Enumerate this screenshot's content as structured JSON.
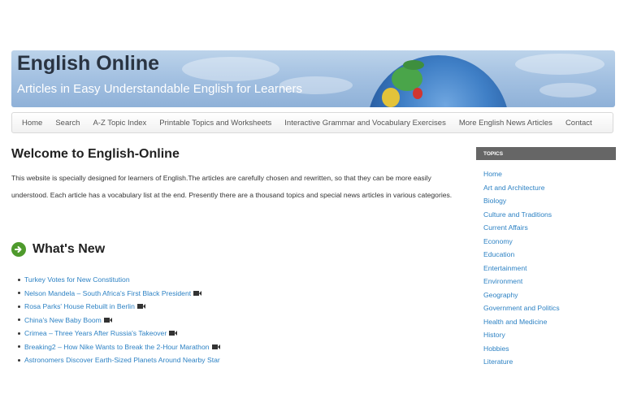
{
  "header": {
    "site_title": "English Online",
    "tagline": "Articles in Easy Understandable English for Learners"
  },
  "nav": {
    "items": [
      {
        "label": "Home"
      },
      {
        "label": "Search"
      },
      {
        "label": "A-Z Topic Index"
      },
      {
        "label": "Printable Topics and Worksheets"
      },
      {
        "label": "Interactive Grammar and Vocabulary Exercises"
      },
      {
        "label": "More English News Articles"
      },
      {
        "label": "Contact"
      }
    ]
  },
  "main": {
    "welcome_title": "Welcome to English-Online",
    "intro_text": "This website is specially designed for learners of English.The articles are carefully chosen and rewritten, so that they can be more easily understood. Each article has a vocabulary list at the end. Presently there are a thousand topics and special news articles in various categories.",
    "whats_new_title": "What's New",
    "news_items": [
      {
        "title": "Turkey Votes for New Constitution"
      },
      {
        "title": "Nelson Mandela – South Africa's First Black President"
      },
      {
        "title": "Rosa Parks' House Rebuilt in Berlin"
      },
      {
        "title": "China's New Baby Boom"
      },
      {
        "title": "Crimea – Three Years After Russia's Takeover"
      },
      {
        "title": "Breaking2 – How Nike Wants to Break the 2-Hour Marathon"
      },
      {
        "title": "Astronomers Discover Earth-Sized Planets Around Nearby Star"
      }
    ]
  },
  "sidebar": {
    "header": "TOPICS",
    "topics": [
      {
        "label": "Home"
      },
      {
        "label": "Art and Architecture"
      },
      {
        "label": "Biology"
      },
      {
        "label": "Culture and Traditions"
      },
      {
        "label": "Current Affairs"
      },
      {
        "label": "Economy"
      },
      {
        "label": "Education"
      },
      {
        "label": "Entertainment"
      },
      {
        "label": "Environment"
      },
      {
        "label": "Geography"
      },
      {
        "label": "Government and Politics"
      },
      {
        "label": "Health and Medicine"
      },
      {
        "label": "History"
      },
      {
        "label": "Hobbies"
      },
      {
        "label": "Literature"
      }
    ]
  },
  "icons": {
    "whats_new": "arrow-right-circle-icon",
    "news_video": "video-camera-icon"
  },
  "colors": {
    "link": "#2d82c4",
    "arrow_green": "#4e9a2c",
    "sidebar_header_bg": "#666666"
  }
}
